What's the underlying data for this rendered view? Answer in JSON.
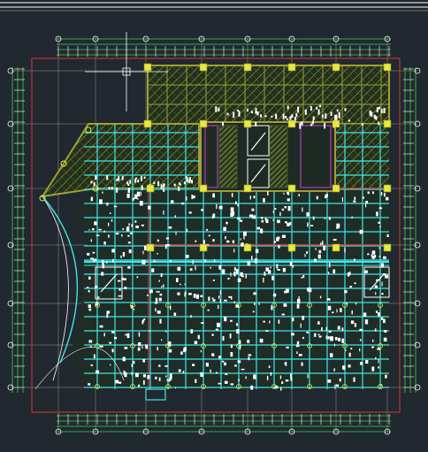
{
  "app": {
    "type": "cad-drawing-viewport",
    "background": "#212830"
  },
  "colors": {
    "background": "#212830",
    "dimension_lines": "#39d44a",
    "grid_axes": "#c8c8a0",
    "outer_border": "#d43838",
    "beams": "#3fe6e6",
    "hatch_slab": "#a0a036",
    "hatch_fill": "#22301e",
    "column_markers": "#e8e840",
    "white_marks": "#ffffff",
    "core_fill": "#3c5a2a",
    "magenta": "#d040d0",
    "red_accent": "#e04040"
  },
  "icons": {
    "cursor": "crosshair-cursor-icon",
    "axis_bubble": "axis-bubble-icon",
    "column": "column-marker-icon"
  }
}
